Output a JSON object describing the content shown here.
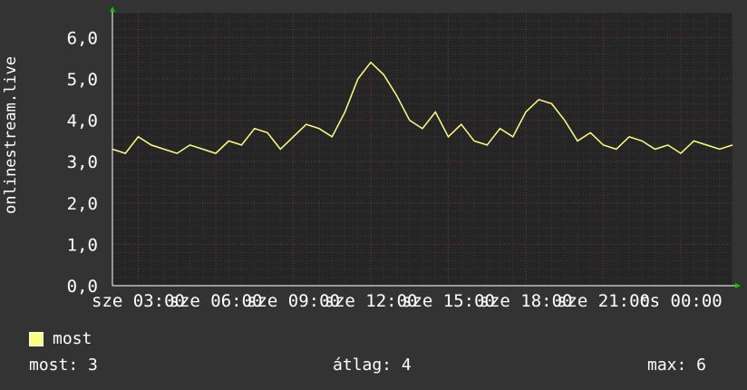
{
  "chart_data": {
    "type": "line",
    "ylabel": "onlinestream.live",
    "ylim": [
      0,
      6.6
    ],
    "xlim": [
      0,
      24
    ],
    "yticks": [
      {
        "v": 0,
        "label": "0,0"
      },
      {
        "v": 1,
        "label": "1,0"
      },
      {
        "v": 2,
        "label": "2,0"
      },
      {
        "v": 3,
        "label": "3,0"
      },
      {
        "v": 4,
        "label": "4,0"
      },
      {
        "v": 5,
        "label": "5,0"
      },
      {
        "v": 6,
        "label": "6,0"
      }
    ],
    "xticks": [
      {
        "v": 1.0,
        "label": "sze 03:00"
      },
      {
        "v": 4.0,
        "label": "sze 06:00"
      },
      {
        "v": 7.0,
        "label": "sze 09:00"
      },
      {
        "v": 10.0,
        "label": "sze 12:00"
      },
      {
        "v": 13.0,
        "label": "sze 15:00"
      },
      {
        "v": 16.0,
        "label": "sze 18:00"
      },
      {
        "v": 19.0,
        "label": "sze 21:00"
      },
      {
        "v": 22.0,
        "label": "cs 00:00"
      }
    ],
    "series": [
      {
        "name": "most",
        "color": "#ffff7f",
        "x": [
          0,
          0.5,
          1,
          1.5,
          2,
          2.5,
          3,
          3.5,
          4,
          4.5,
          5,
          5.5,
          6,
          6.5,
          7,
          7.5,
          8,
          8.5,
          9,
          9.5,
          10,
          10.5,
          11,
          11.5,
          12,
          12.5,
          13,
          13.5,
          14,
          14.5,
          15,
          15.5,
          16,
          16.5,
          17,
          17.5,
          18,
          18.5,
          19,
          19.5,
          20,
          20.5,
          21,
          21.5,
          22,
          22.5,
          23,
          23.5,
          24
        ],
        "values": [
          3.3,
          3.2,
          3.6,
          3.4,
          3.3,
          3.2,
          3.4,
          3.3,
          3.2,
          3.5,
          3.4,
          3.8,
          3.7,
          3.3,
          3.6,
          3.9,
          3.8,
          3.6,
          4.2,
          5.0,
          5.4,
          5.1,
          4.6,
          4.0,
          3.8,
          4.2,
          3.6,
          3.9,
          3.5,
          3.4,
          3.8,
          3.6,
          4.2,
          4.5,
          4.4,
          4.0,
          3.5,
          3.7,
          3.4,
          3.3,
          3.6,
          3.5,
          3.3,
          3.4,
          3.2,
          3.5,
          3.4,
          3.3,
          3.4
        ]
      }
    ]
  },
  "legend": {
    "label": "most"
  },
  "stats": {
    "current": "most: 3",
    "average": "átlag: 4",
    "max": "max: 6"
  }
}
